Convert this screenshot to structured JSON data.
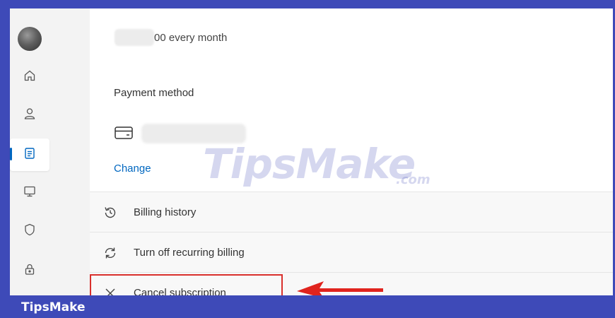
{
  "subscription": {
    "amount_suffix": "00 every month",
    "payment_method_label": "Payment method",
    "change_link": "Change"
  },
  "sidebar": {
    "items": [
      {
        "name": "home",
        "icon": "home-icon"
      },
      {
        "name": "account",
        "icon": "person-icon"
      },
      {
        "name": "subscriptions",
        "icon": "receipt-icon",
        "active": true
      },
      {
        "name": "devices",
        "icon": "monitor-icon"
      },
      {
        "name": "security",
        "icon": "shield-icon"
      },
      {
        "name": "privacy",
        "icon": "lock-icon"
      }
    ]
  },
  "actions": [
    {
      "label": "Billing history",
      "icon": "history-icon"
    },
    {
      "label": "Turn off recurring billing",
      "icon": "refresh-icon"
    },
    {
      "label": "Cancel subscription",
      "icon": "close-icon"
    }
  ],
  "watermark": {
    "main": "TipsMake",
    "suffix": ".com"
  },
  "footer": {
    "brand": "TipsMake"
  },
  "colors": {
    "accent": "#0067c0",
    "frame": "#3e4ab8",
    "highlight": "#d9302c"
  }
}
